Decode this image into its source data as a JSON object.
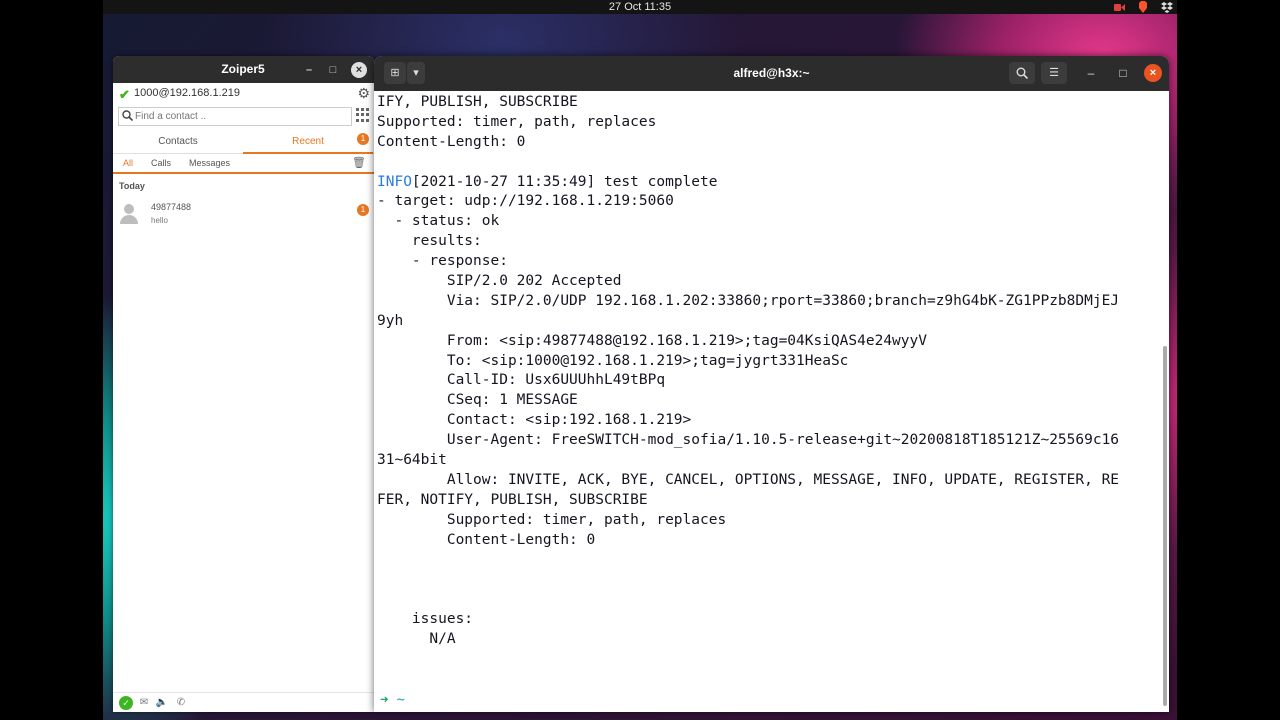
{
  "topbar": {
    "clock": "27 Oct  11:35"
  },
  "zoiper": {
    "title": "Zoiper5",
    "account": "1000@192.168.1.219",
    "search_placeholder": "Find a contact ..",
    "tabs": [
      "Contacts",
      "Recent"
    ],
    "recent_badge": "1",
    "subtabs": [
      "All",
      "Calls",
      "Messages"
    ],
    "section": "Today",
    "recent_items": [
      {
        "number": "49877488",
        "message": "hello",
        "badge": "1"
      }
    ]
  },
  "terminal": {
    "title": "alfred@h3x:~",
    "lines": [
      "IFY, PUBLISH, SUBSCRIBE",
      "Supported: timer, path, replaces",
      "Content-Length: 0",
      "",
      "[2021-10-27 11:35:49] test complete",
      "- target: udp://192.168.1.219:5060",
      "  - status: ok",
      "    results:",
      "    - response:",
      "        SIP/2.0 202 Accepted",
      "        Via: SIP/2.0/UDP 192.168.1.202:33860;rport=33860;branch=z9hG4bK-ZG1PPzb8DMjEJ",
      "9yh",
      "        From: <sip:49877488@192.168.1.219>;tag=04KsiQAS4e24wyyV",
      "        To: <sip:1000@192.168.1.219>;tag=jygrt331HeaSc",
      "        Call-ID: Usx6UUUhhL49tBPq",
      "        CSeq: 1 MESSAGE",
      "        Contact: <sip:192.168.1.219>",
      "        User-Agent: FreeSWITCH-mod_sofia/1.10.5-release+git~20200818T185121Z~25569c16",
      "31~64bit",
      "        Allow: INVITE, ACK, BYE, CANCEL, OPTIONS, MESSAGE, INFO, UPDATE, REGISTER, RE",
      "FER, NOTIFY, PUBLISH, SUBSCRIBE",
      "        Supported: timer, path, replaces",
      "        Content-Length: 0",
      "",
      "",
      "",
      "    issues:",
      "      N/A"
    ],
    "info_tag": "INFO",
    "prompt_arrow": "➜",
    "prompt_dir": "~"
  }
}
